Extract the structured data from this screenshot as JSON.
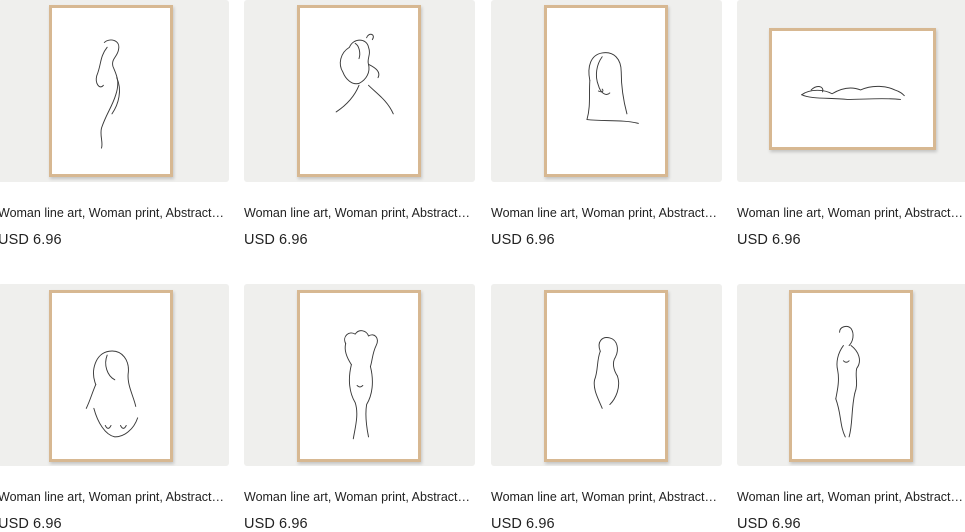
{
  "listings": [
    {
      "title": "Woman line art, Woman print, Abstract woman print, Line art print, Woman line drawing",
      "price": "USD 6.96",
      "art_icon": "woman-silhouette-line-art"
    },
    {
      "title": "Woman line art, Woman print, Abstract woman print, Line art print, Woman line drawing",
      "price": "USD 6.96",
      "art_icon": "woman-face-bun-line-art"
    },
    {
      "title": "Woman line art, Woman print, Abstract woman print, Line art print, Woman line drawing",
      "price": "USD 6.96",
      "art_icon": "woman-face-line-art"
    },
    {
      "title": "Woman line art, Woman print, Abstract woman print, Line art print, Woman line drawing",
      "price": "USD 6.96",
      "art_icon": "reclining-woman-line-art"
    },
    {
      "title": "Woman line art, Woman print, Abstract woman print, Line art print, Woman line drawing",
      "price": "USD 6.96",
      "art_icon": "woman-bust-line-art"
    },
    {
      "title": "Woman line art, Woman print, Abstract woman print, Line art print, Woman line drawing",
      "price": "USD 6.96",
      "art_icon": "woman-arms-raised-line-art"
    },
    {
      "title": "Woman line art, Woman print, Abstract woman print, Line art print, Woman line drawing",
      "price": "USD 6.96",
      "art_icon": "woman-profile-line-art"
    },
    {
      "title": "Woman line art, Woman print, Abstract woman print, Line art print, Woman line drawing",
      "price": "USD 6.96",
      "art_icon": "woman-standing-figure-line-art"
    }
  ],
  "colors": {
    "frame": "#d7b892",
    "thumb_bg": "#efefed",
    "text": "#222222"
  }
}
